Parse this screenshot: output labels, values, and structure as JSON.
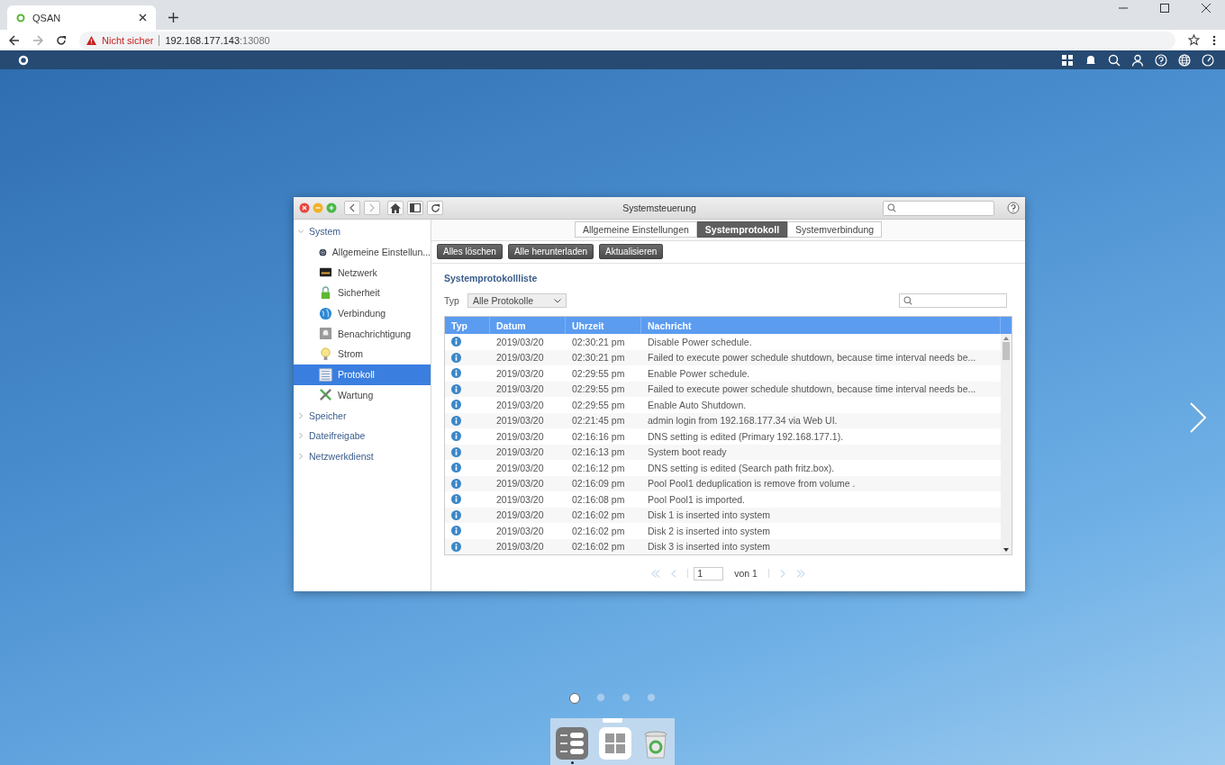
{
  "browser": {
    "tab_title": "QSAN",
    "url_warning": "Nicht sicher",
    "url_host": "192.168.177.143",
    "url_port": ":13080"
  },
  "window": {
    "title": "Systemsteuerung"
  },
  "sidebar": [
    {
      "label": "System",
      "expanded": true,
      "children": [
        {
          "label": "Allgemeine Einstellun...",
          "kind": "gear",
          "selected": false
        },
        {
          "label": "Netzwerk",
          "kind": "network",
          "selected": false
        },
        {
          "label": "Sicherheit",
          "kind": "lock",
          "selected": false
        },
        {
          "label": "Verbindung",
          "kind": "globe",
          "selected": false
        },
        {
          "label": "Benachrichtigung",
          "kind": "notify",
          "selected": false
        },
        {
          "label": "Strom",
          "kind": "bulb",
          "selected": false
        },
        {
          "label": "Protokoll",
          "kind": "log",
          "selected": true
        },
        {
          "label": "Wartung",
          "kind": "tools",
          "selected": false
        }
      ]
    },
    {
      "label": "Speicher",
      "expanded": false
    },
    {
      "label": "Dateifreigabe",
      "expanded": false
    },
    {
      "label": "Netzwerkdienst",
      "expanded": false
    }
  ],
  "tabs": [
    {
      "label": "Allgemeine Einstellungen",
      "selected": false
    },
    {
      "label": "Systemprotokoll",
      "selected": true
    },
    {
      "label": "Systemverbindung",
      "selected": false
    }
  ],
  "buttons": [
    "Alles löschen",
    "Alle herunterladen",
    "Aktualisieren"
  ],
  "section_title": "Systemprotokollliste",
  "filter": {
    "label": "Typ",
    "value": "Alle Protokolle"
  },
  "table": {
    "columns": [
      "Typ",
      "Datum",
      "Uhrzeit",
      "Nachricht"
    ],
    "rows": [
      {
        "kind": "info",
        "date": "2019/03/20",
        "time": "02:30:21 pm",
        "message": "Disable Power schedule."
      },
      {
        "kind": "info",
        "date": "2019/03/20",
        "time": "02:30:21 pm",
        "message": "Failed to execute power schedule shutdown, because time interval needs be..."
      },
      {
        "kind": "info",
        "date": "2019/03/20",
        "time": "02:29:55 pm",
        "message": "Enable Power schedule."
      },
      {
        "kind": "info",
        "date": "2019/03/20",
        "time": "02:29:55 pm",
        "message": "Failed to execute power schedule shutdown, because time interval needs be..."
      },
      {
        "kind": "info",
        "date": "2019/03/20",
        "time": "02:29:55 pm",
        "message": "Enable Auto Shutdown."
      },
      {
        "kind": "info",
        "date": "2019/03/20",
        "time": "02:21:45 pm",
        "message": "admin login from 192.168.177.34 via Web UI."
      },
      {
        "kind": "info",
        "date": "2019/03/20",
        "time": "02:16:16 pm",
        "message": "DNS setting is edited (Primary 192.168.177.1)."
      },
      {
        "kind": "info",
        "date": "2019/03/20",
        "time": "02:16:13 pm",
        "message": "System boot ready"
      },
      {
        "kind": "info",
        "date": "2019/03/20",
        "time": "02:16:12 pm",
        "message": "DNS setting is edited (Search path fritz.box)."
      },
      {
        "kind": "info",
        "date": "2019/03/20",
        "time": "02:16:09 pm",
        "message": "Pool Pool1 deduplication is remove from volume ."
      },
      {
        "kind": "info",
        "date": "2019/03/20",
        "time": "02:16:08 pm",
        "message": "Pool Pool1 is imported."
      },
      {
        "kind": "info",
        "date": "2019/03/20",
        "time": "02:16:02 pm",
        "message": "Disk 1 is inserted into system"
      },
      {
        "kind": "info",
        "date": "2019/03/20",
        "time": "02:16:02 pm",
        "message": "Disk 2 is inserted into system"
      },
      {
        "kind": "info",
        "date": "2019/03/20",
        "time": "02:16:02 pm",
        "message": "Disk 3 is inserted into system"
      }
    ]
  },
  "pagination": {
    "page": "1",
    "of": "von 1"
  },
  "page_dots": [
    {
      "selected": true
    },
    {
      "selected": false
    },
    {
      "selected": false
    },
    {
      "selected": false
    }
  ],
  "dock": [
    {
      "kind": "settings",
      "running": true
    },
    {
      "kind": "apps",
      "running": false
    },
    {
      "kind": "trash",
      "running": false
    }
  ]
}
